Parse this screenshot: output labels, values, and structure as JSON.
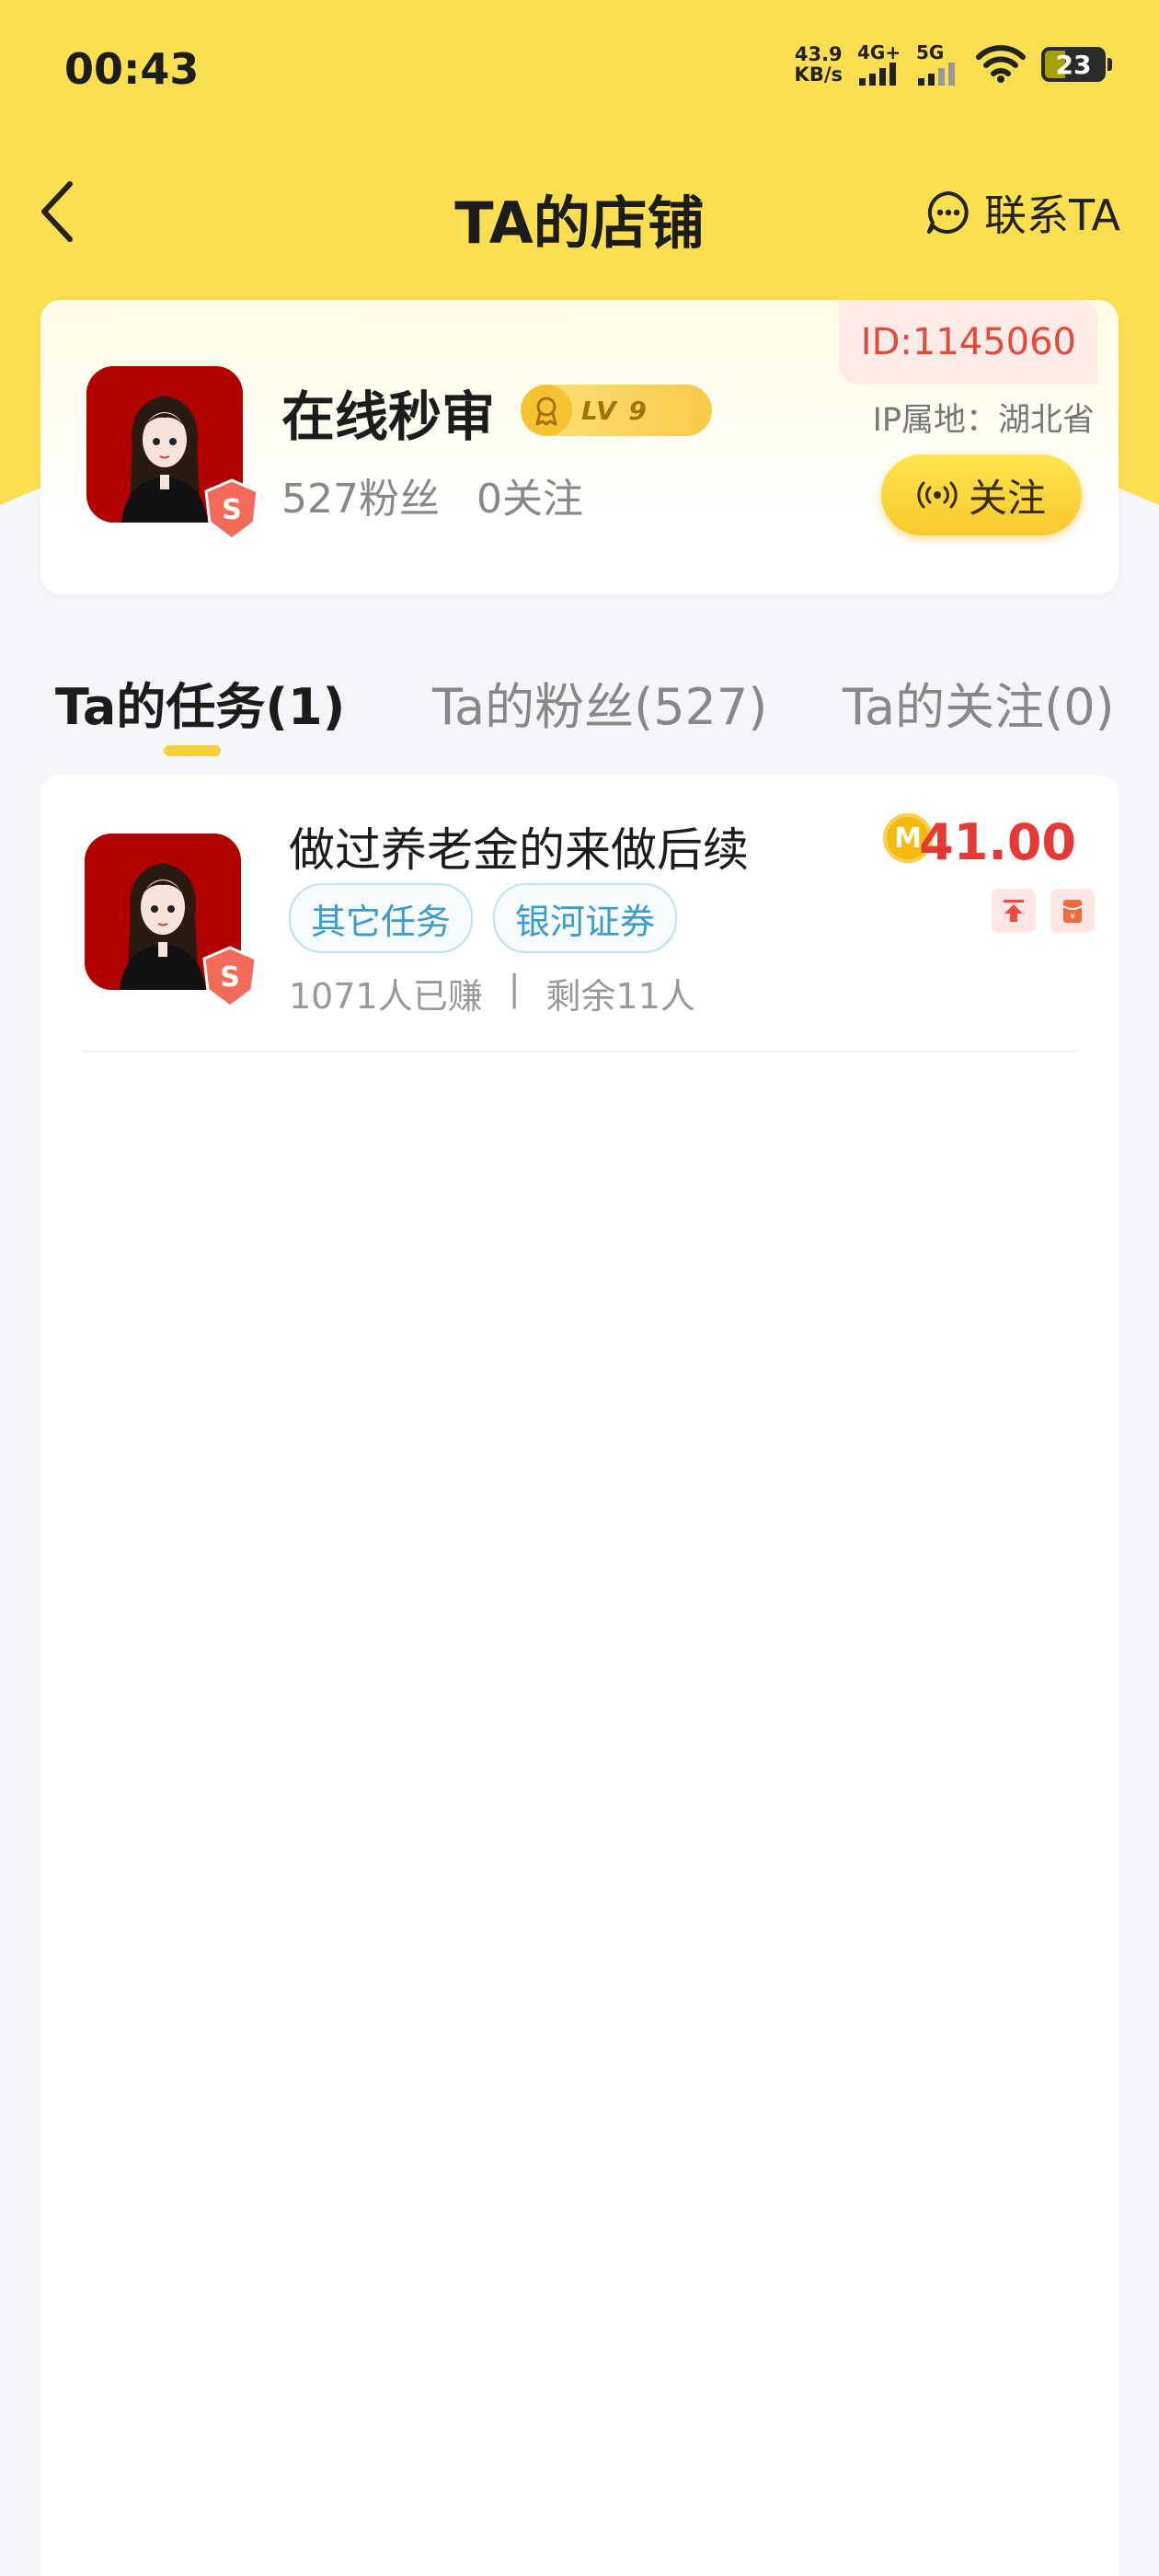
{
  "status_bar": {
    "time": "00:43",
    "net_speed_value": "43.9",
    "net_speed_unit": "KB/s",
    "signal1": "4G+",
    "signal2": "5G",
    "battery": "23"
  },
  "header": {
    "title": "TA的店铺",
    "contact_label": "联系TA"
  },
  "profile": {
    "id_label": "ID:1145060",
    "name": "在线秒审",
    "level": "LV 9",
    "fans": "527粉丝",
    "following": "0关注",
    "ip_location": "IP属地：湖北省",
    "follow_label": "关注"
  },
  "tabs": [
    {
      "label": "Ta的任务(1)"
    },
    {
      "label": "Ta的粉丝(527)"
    },
    {
      "label": "Ta的关注(0)"
    }
  ],
  "tasks": [
    {
      "title": "做过养老金的来做后续",
      "tags": [
        "其它任务",
        "银河证券"
      ],
      "earned": "1071人已赚",
      "separator": "|",
      "remaining": "剩余11人",
      "coin_letter": "M",
      "price": "41.00"
    }
  ],
  "colors": {
    "brand_yellow": "#fcdf50",
    "price_red": "#e53935",
    "tag_blue": "#3a9bd0"
  }
}
